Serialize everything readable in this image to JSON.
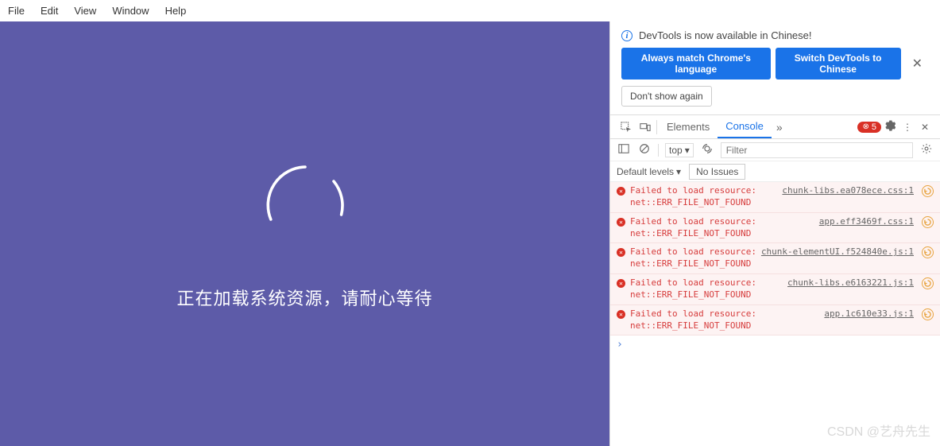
{
  "menubar": {
    "items": [
      "File",
      "Edit",
      "View",
      "Window",
      "Help"
    ]
  },
  "app": {
    "loading_text": "正在加载系统资源，请耐心等待"
  },
  "banner": {
    "message": "DevTools is now available in Chinese!",
    "btn_match": "Always match Chrome's language",
    "btn_switch": "Switch DevTools to Chinese",
    "btn_dont_show": "Don't show again"
  },
  "devtools": {
    "tabs": {
      "elements": "Elements",
      "console": "Console"
    },
    "error_count": "5",
    "toolbar": {
      "context": "top",
      "filter_placeholder": "Filter"
    },
    "toolbar2": {
      "levels": "Default levels",
      "no_issues": "No Issues"
    },
    "errors": [
      {
        "msg": "Failed to load resource: net::ERR_FILE_NOT_FOUND",
        "src": "chunk-libs.ea078ece.css:1"
      },
      {
        "msg": "Failed to load resource: net::ERR_FILE_NOT_FOUND",
        "src": "app.eff3469f.css:1"
      },
      {
        "msg": "Failed to load resource: net::ERR_FILE_NOT_FOUND",
        "src": "chunk-elementUI.f524840e.js:1"
      },
      {
        "msg": "Failed to load resource: net::ERR_FILE_NOT_FOUND",
        "src": "chunk-libs.e6163221.js:1"
      },
      {
        "msg": "Failed to load resource: net::ERR_FILE_NOT_FOUND",
        "src": "app.1c610e33.js:1"
      }
    ],
    "prompt": "›"
  },
  "watermark": "CSDN @艺舟先生"
}
